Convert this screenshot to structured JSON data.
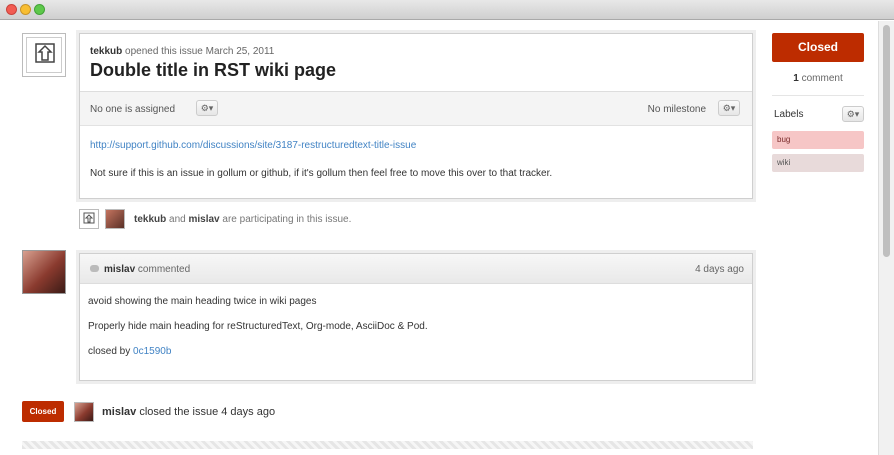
{
  "window": {},
  "issue": {
    "author": "tekkub",
    "meta_text": "opened this issue March 25, 2011",
    "title": "Double title in RST wiki page",
    "assignee_text": "No one is assigned",
    "milestone_text": "No milestone",
    "gear_label": "⚙▾",
    "link": "http://support.github.com/discussions/site/3187-restructuredtext-title-issue",
    "body_text": "Not sure if this is an issue in gollum or github, if it's gollum then feel free to move this over to that tracker."
  },
  "participants": {
    "user1": "tekkub",
    "and_text": "and",
    "user2": "mislav",
    "suffix": "are participating in this issue."
  },
  "comment": {
    "author": "mislav",
    "action": "commented",
    "time": "4 days ago",
    "line1": "avoid showing the main heading twice in wiki pages",
    "line2": "Properly hide main heading for reStructuredText, Org-mode, AsciiDoc & Pod.",
    "closed_by_text": "closed by",
    "commit": "0c1590b"
  },
  "event": {
    "badge": "Closed",
    "user": "mislav",
    "text": "closed the issue 4 days ago"
  },
  "sidebar": {
    "state_button": "Closed",
    "comment_count": "1",
    "comment_word": "comment",
    "labels_title": "Labels",
    "labels": [
      {
        "name": "bug",
        "color": "#f6c6c6"
      },
      {
        "name": "wiki",
        "color": "#e8dada"
      }
    ]
  },
  "colors": {
    "closed_red": "#bd2c00",
    "link_blue": "#4183c4"
  }
}
